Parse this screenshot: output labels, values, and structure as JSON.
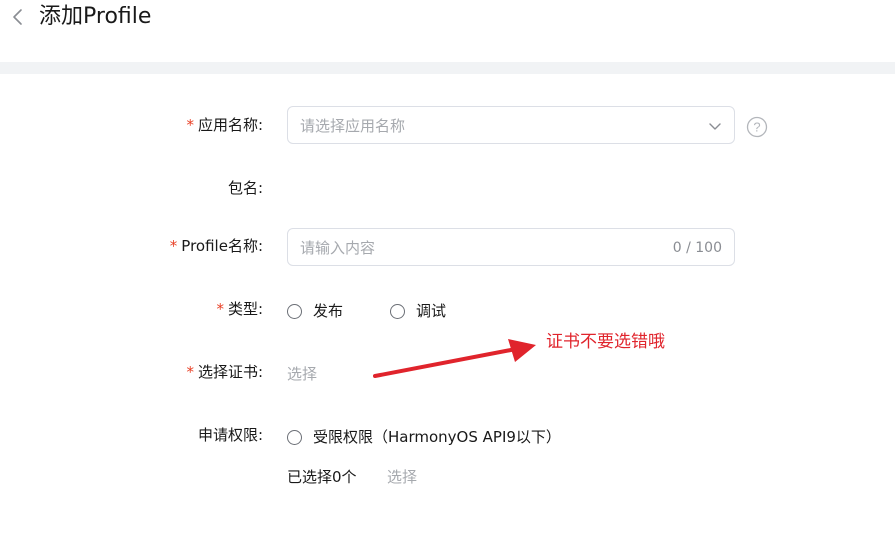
{
  "header": {
    "back_icon": "chevron-left-icon",
    "title": "添加Profile"
  },
  "form": {
    "required_mark": "*",
    "app_name": {
      "label": "应用名称:",
      "placeholder": "请选择应用名称",
      "dropdown_icon": "chevron-down-icon",
      "help_icon": "question-circle-icon",
      "help_symbol": "?"
    },
    "package_name": {
      "label": "包名:"
    },
    "profile_name": {
      "label": "Profile名称:",
      "placeholder": "请输入内容",
      "counter": "0 / 100"
    },
    "type": {
      "label": "类型:",
      "options": [
        "发布",
        "调试"
      ]
    },
    "certificate": {
      "label": "选择证书:",
      "select_link": "选择"
    },
    "permissions": {
      "label": "申请权限:",
      "option": "受限权限（HarmonyOS API9以下）",
      "selected_count": "已选择0个",
      "select_link": "选择"
    }
  },
  "annotation": {
    "text": "证书不要选错哦",
    "color": "#e0242c"
  },
  "colors": {
    "required": "#e84026",
    "placeholder": "#a6a9ae",
    "border": "#dcdfe6",
    "band": "#f1f3f5"
  }
}
